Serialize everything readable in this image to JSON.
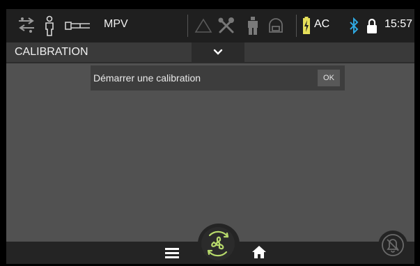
{
  "status_bar": {
    "mode": "MPV",
    "power": "AC",
    "time": "15:57",
    "icons": [
      "connection-arrows-icon",
      "person-icon",
      "mask-icon",
      "warning-triangle-icon",
      "tools-icon",
      "suit-icon",
      "hood-icon",
      "battery-charging-icon",
      "bluetooth-icon",
      "lock-icon"
    ]
  },
  "header": {
    "title": "CALIBRATION",
    "dropdown_icon": "chevron-down-icon"
  },
  "calibration": {
    "label": "Démarrer une calibration",
    "ok_label": "OK"
  },
  "bottom_bar": {
    "icons": [
      "menu-icon",
      "fan-icon",
      "home-icon",
      "alarm-bell-icon"
    ]
  },
  "colors": {
    "background": "#515151",
    "bar": "#1f1f1f",
    "fan_accent": "#b7d96b",
    "bluetooth": "#2fa8e0",
    "battery_fill": "#e6e05a"
  }
}
